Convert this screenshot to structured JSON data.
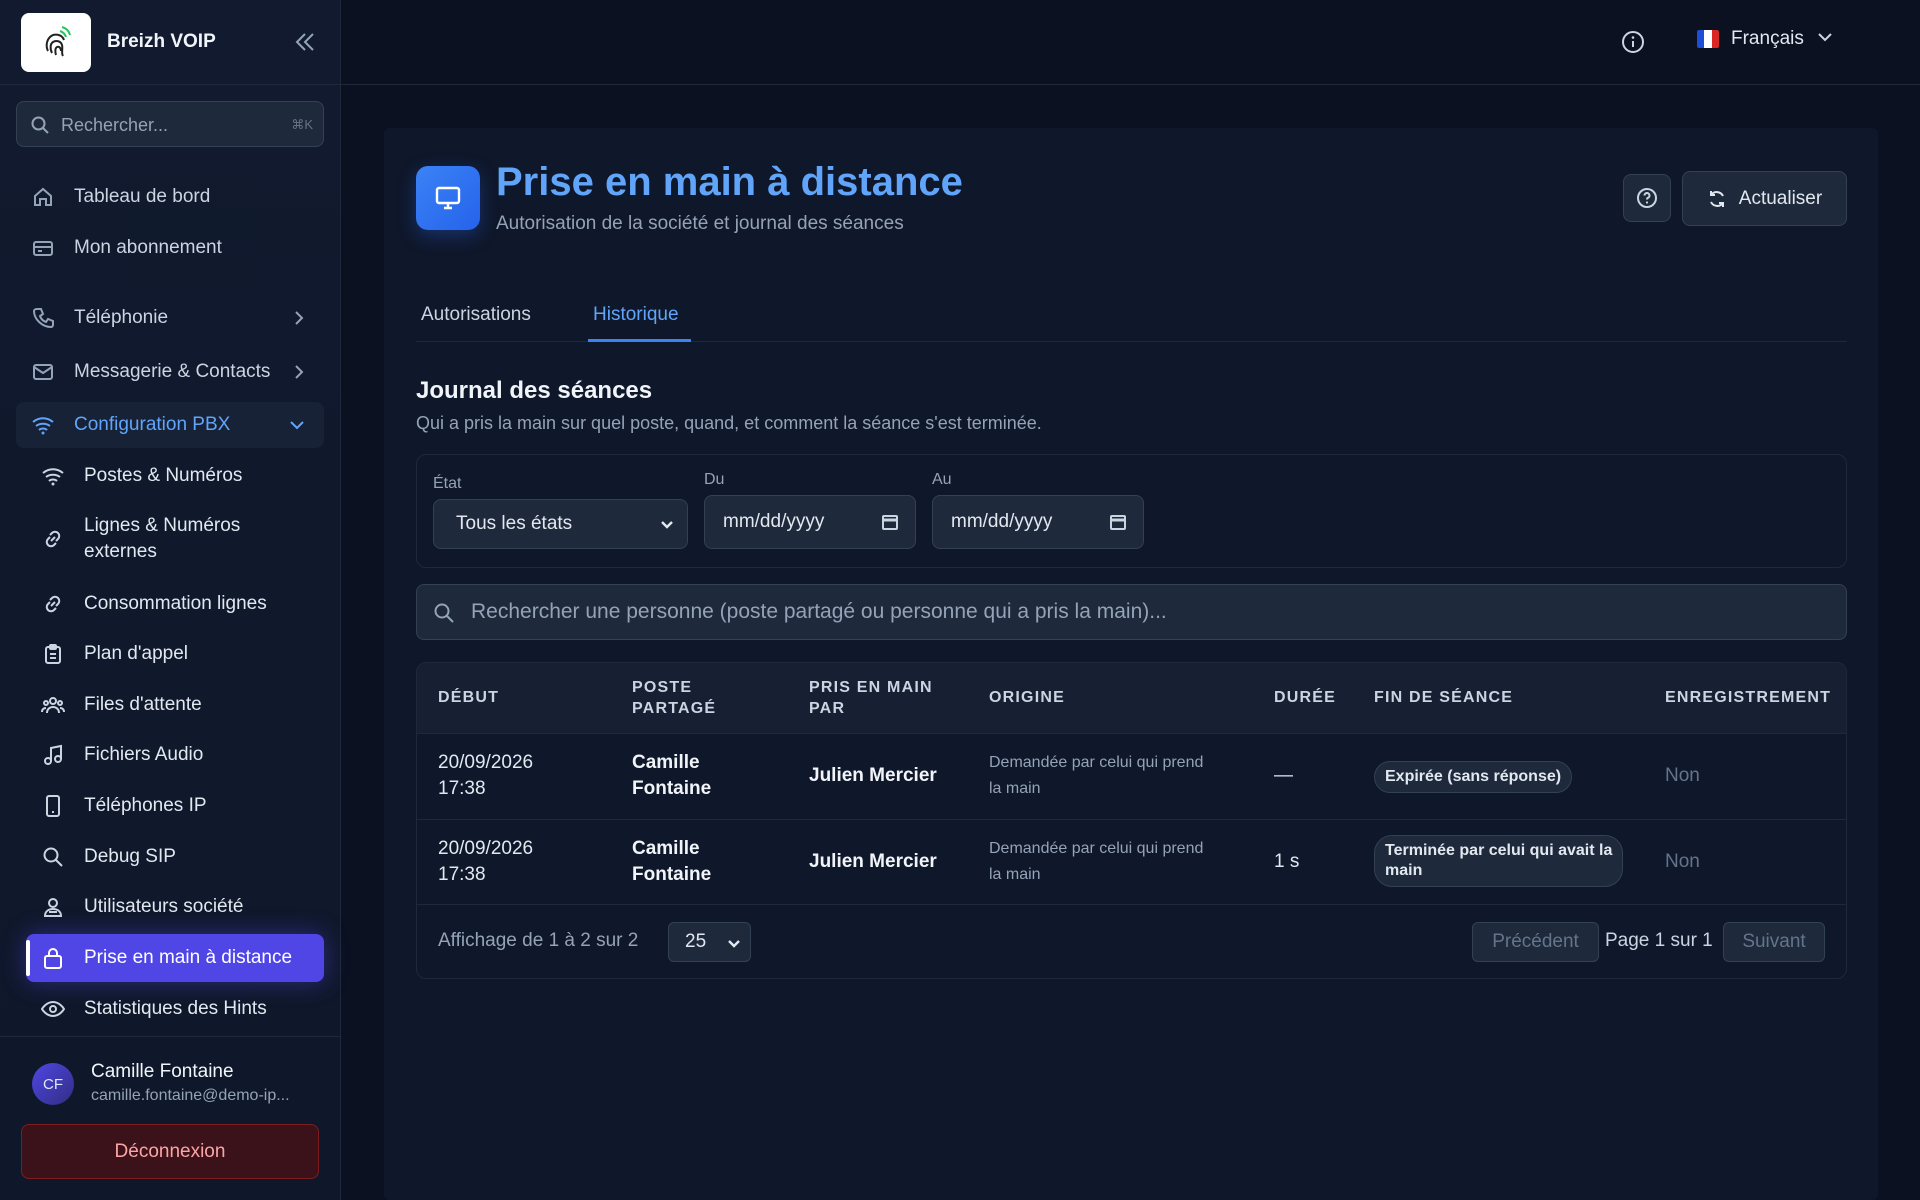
{
  "sidebar": {
    "brand_name": "Breizh VOIP",
    "search": {
      "placeholder": "Rechercher...",
      "shortcut": "⌘K"
    },
    "nav": [
      {
        "label": "Tableau de bord",
        "icon": "home-icon"
      },
      {
        "label": "Mon abonnement",
        "icon": "card-icon"
      },
      {
        "label": "Téléphonie",
        "icon": "phone-icon"
      },
      {
        "label": "Messagerie & Contacts",
        "icon": "mail-icon"
      },
      {
        "label": "Configuration PBX",
        "icon": "wifi-icon",
        "expanded": true
      }
    ],
    "sub_items": [
      {
        "label": "Postes & Numéros",
        "icon": "wifi-icon"
      },
      {
        "label": "Lignes & Numéros externes",
        "icon": "link-icon"
      },
      {
        "label": "Consommation lignes",
        "icon": "link-icon"
      },
      {
        "label": "Plan d'appel",
        "icon": "clipboard-icon"
      },
      {
        "label": "Files d'attente",
        "icon": "users-icon"
      },
      {
        "label": "Fichiers Audio",
        "icon": "music-icon"
      },
      {
        "label": "Téléphones IP",
        "icon": "smartphone-icon"
      },
      {
        "label": "Debug SIP",
        "icon": "search-icon"
      },
      {
        "label": "Utilisateurs société",
        "icon": "user-group-icon"
      },
      {
        "label": "Prise en main à distance",
        "icon": "lock-icon",
        "active": true
      },
      {
        "label": "Statistiques des Hints",
        "icon": "eye-icon"
      }
    ],
    "user": {
      "initials": "CF",
      "name": "Camille Fontaine",
      "email": "camille.fontaine@demo-ip..."
    },
    "logout_label": "Déconnexion"
  },
  "topbar": {
    "language": "Français",
    "flag_colors": [
      "#1d4ed8",
      "#ffffff",
      "#dc2626"
    ]
  },
  "page": {
    "title": "Prise en main à distance",
    "subtitle": "Autorisation de la société et journal des séances",
    "refresh_label": "Actualiser",
    "tabs": [
      {
        "label": "Autorisations",
        "active": false
      },
      {
        "label": "Historique",
        "active": true
      }
    ]
  },
  "journal": {
    "title": "Journal des séances",
    "subtitle": "Qui a pris la main sur quel poste, quand, et comment la séance s'est terminée.",
    "filters": {
      "state_label": "État",
      "state_value": "Tous les états",
      "from_label": "Du",
      "from_value": "mm/dd/yyyy",
      "to_label": "Au",
      "to_value": "mm/dd/yyyy"
    },
    "search_placeholder": "Rechercher une personne (poste partagé ou personne qui a pris la main)...",
    "columns": [
      "DÉBUT",
      "POSTE\nPARTAGÉ",
      "PRIS EN MAIN\nPAR",
      "ORIGINE",
      "DURÉE",
      "FIN DE SÉANCE",
      "ENREGISTREMENT"
    ],
    "rows": [
      {
        "debut": "20/09/2026\n17:38",
        "poste": "Camille\nFontaine",
        "pris_par": "Julien Mercier",
        "origine": "Demandée par celui qui prend\nla main",
        "duree": "—",
        "fin": "Expirée (sans réponse)",
        "enregistrement": "Non"
      },
      {
        "debut": "20/09/2026\n17:38",
        "poste": "Camille\nFontaine",
        "pris_par": "Julien Mercier",
        "origine": "Demandée par celui qui prend\nla main",
        "duree": "1 s",
        "fin": "Terminée par celui qui avait la\nmain",
        "enregistrement": "Non"
      }
    ],
    "footer": {
      "summary": "Affichage de 1 à 2 sur 2",
      "per_page": "25",
      "prev_label": "Précédent",
      "page_info": "Page 1 sur 1",
      "next_label": "Suivant"
    }
  },
  "colors": {
    "accent": "#60a5fa",
    "active_nav": "#4f46e5",
    "background": "#0b1121",
    "panel": "#0f172a"
  }
}
